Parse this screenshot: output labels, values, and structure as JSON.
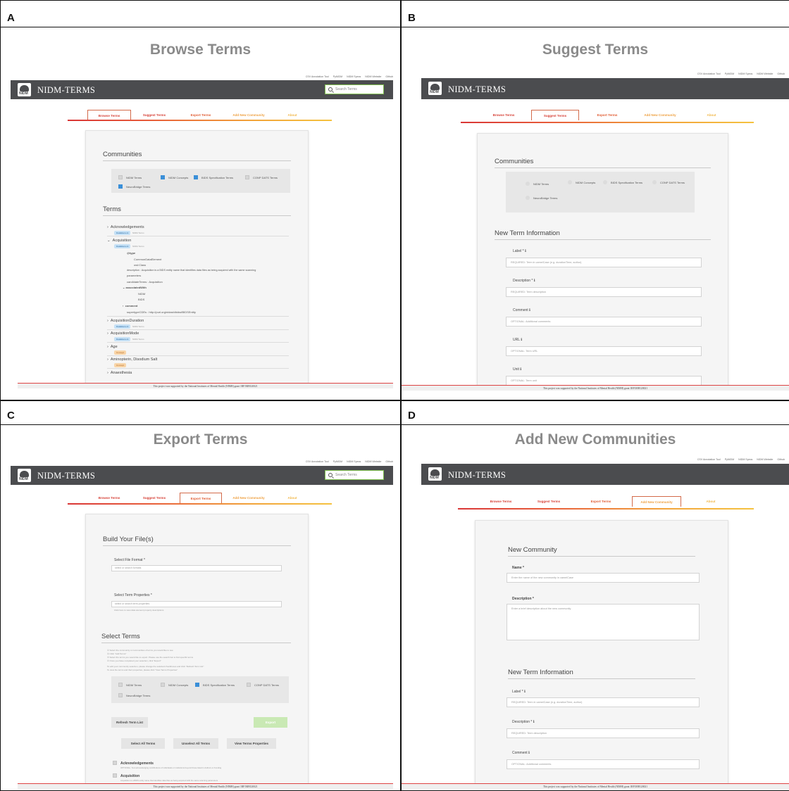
{
  "panels": [
    {
      "label": "A",
      "title": "Browse Terms"
    },
    {
      "label": "B",
      "title": "Suggest Terms"
    },
    {
      "label": "C",
      "title": "Export Terms"
    },
    {
      "label": "D",
      "title": "Add New Communities"
    }
  ],
  "app": {
    "brand": "NIDM-TERMS",
    "logo_text": "NIDM",
    "search_placeholder": "Search Terms",
    "top_links": [
      "CSV Annotation Tool",
      "PyNIDM",
      "NIDM Specs",
      "NIDM Website",
      "Github"
    ],
    "tabs": [
      "Browse Terms",
      "Suggest Terms",
      "Export Terms",
      "Add New Community",
      "About"
    ],
    "footer": "This project was supported by the National Institutes of Mental Health (NIMH) grant 1RF1MH120021",
    "colors": {
      "header": "#4b4c4f",
      "tab_red": "#d93636",
      "tab_orange": "#f2a43a",
      "checkbox_on": "#3a8fd8",
      "search_border": "#7fbf4f"
    }
  },
  "browse": {
    "communities_heading": "Communities",
    "communities": [
      "NIDM Terms",
      "NIDM Concepts",
      "BIDS Specification Terms",
      "CONP DATS Terms",
      "NeuroBridge Terms"
    ],
    "terms_heading": "Terms",
    "terms": {
      "t1": "Acknowledgements",
      "t2": "Acquisition",
      "t3": "AcquisitionDuration",
      "t4": "AcquisitionMode",
      "t5": "Age",
      "t6": "Aminopterin, Disodium Salt",
      "t7": "Anaesthesia"
    },
    "badge_data_element": "DataElement",
    "badge_nidm_terms": "NIDM Terms",
    "badge_concept": "Concept",
    "detail": {
      "type_key": "@type",
      "type_v1": "CommonDataElement",
      "type_v2": "owl:Class",
      "description": "description : Acquisition is a BIDS entity name that identifies data files as being acquired with the same scanning",
      "description2": "parameters",
      "candidate": "candidateTerms : Acquisition",
      "assoc_key": "associatedWith",
      "assoc_v1": "NIDM",
      "assoc_v2": "BIDS",
      "comment": "comment",
      "supertype": "supertypeCDEs : http://purl.org/nidash/bids#BIDSEntity"
    }
  },
  "suggest": {
    "communities_heading": "Communities",
    "communities": [
      "NIDM Terms",
      "NIDM Concepts",
      "BIDS Specification Terms",
      "CONP DATS Terms",
      "NeuroBridge Terms"
    ],
    "heading": "New Term Information",
    "fields": [
      {
        "label": "Label * ℹ",
        "placeholder": "REQUIRED: Term in camelCase (e.g. durationTime, author)"
      },
      {
        "label": "Description * ℹ",
        "placeholder": "REQUIRED: Term description"
      },
      {
        "label": "Comment ℹ",
        "placeholder": "OPTIONAL: Additional comments"
      },
      {
        "label": "URL ℹ",
        "placeholder": "OPTIONAL: Term URL"
      },
      {
        "label": "Unit ℹ",
        "placeholder": "OPTIONAL: Term unit"
      }
    ]
  },
  "export": {
    "build_heading": "Build Your File(s)",
    "format_label": "Select File Format *",
    "format_placeholder": "select or search formats",
    "props_label": "Select Term Properties *",
    "props_placeholder": "select or search term properties",
    "props_hint": "Click here to view data element property descriptions",
    "select_heading": "Select Terms",
    "instructions": [
      "① Select the community or communities of terms you would like to see",
      "② Click \"Add Terms\"",
      "③ Select the terms you would like to export. Please use the search bar to find specific terms",
      "④ Once you have completed your selection, click \"Export\"",
      "To edit your community selection, please change the selected checkboxes and click \"Refresh Term List\"",
      "To view the terms and their properties, please click \"View Terms Properties\""
    ],
    "communities": [
      "NIDM Terms",
      "NIDM Concepts",
      "BIDS Specification Terms",
      "CONP DATS Terms",
      "NeuroBridge Terms"
    ],
    "refresh": "Refresh Term List",
    "export_btn": "Export",
    "select_all": "Select All Terms",
    "unselect_all": "Unselect All Terms",
    "view_props": "View Terms Properties",
    "term1": "Acknowledgements",
    "term1_desc": "OPTIONAL. Text acknowledging contributions of individuals or institutions beyond those listed in Authors or Funding",
    "term2": "Acquisition",
    "term2_desc": "Acquisition is a BIDS entity name that identifies data files as being acquired with the same scanning parameters"
  },
  "community": {
    "heading": "New Community",
    "name_label": "Name *",
    "name_placeholder": "Enter the name of the new community in camelCase",
    "desc_label": "Description *",
    "desc_placeholder": "Enter a brief description about the new community",
    "term_heading": "New Term Information",
    "fields": [
      {
        "label": "Label * ℹ",
        "placeholder": "REQUIRED: Term in camelCase (e.g. durationTime, author)"
      },
      {
        "label": "Description * ℹ",
        "placeholder": "REQUIRED: Term description"
      },
      {
        "label": "Comment ℹ",
        "placeholder": "OPTIONAL: Additional comments"
      }
    ]
  }
}
